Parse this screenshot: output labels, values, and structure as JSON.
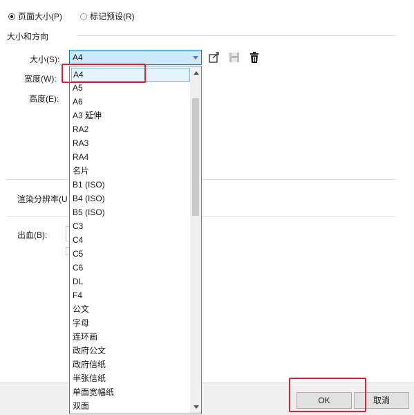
{
  "radios": [
    {
      "label": "页面大小(P)",
      "checked": true
    },
    {
      "label": "标记预设(R)",
      "checked": false
    }
  ],
  "section_title": "大小和方向",
  "labels": {
    "size": "大小(S):",
    "width": "宽度(W):",
    "height": "高度(E):",
    "render": "渲染分辨率(U",
    "bleed": "出血(B):"
  },
  "size_combo": {
    "value": "A4"
  },
  "icons": [
    "export-preset-icon",
    "save-preset-icon",
    "delete-preset-icon"
  ],
  "dropdown_items": [
    "A4",
    "A5",
    "A6",
    "A3 延伸",
    "RA2",
    "RA3",
    "RA4",
    "名片",
    "B1 (ISO)",
    "B4 (ISO)",
    "B5 (ISO)",
    "C3",
    "C4",
    "C5",
    "C6",
    "DL",
    "F4",
    "公文",
    "字母",
    "连环画",
    "政府公文",
    "政府信纸",
    "半张信纸",
    "单面宽幅纸",
    "双面"
  ],
  "selected_index": 0,
  "buttons": {
    "ok": "OK",
    "cancel": "取消"
  },
  "colors": {
    "accent": "#0a7bd6",
    "highlight": "#cce8ff",
    "annotation": "#e0212d"
  }
}
